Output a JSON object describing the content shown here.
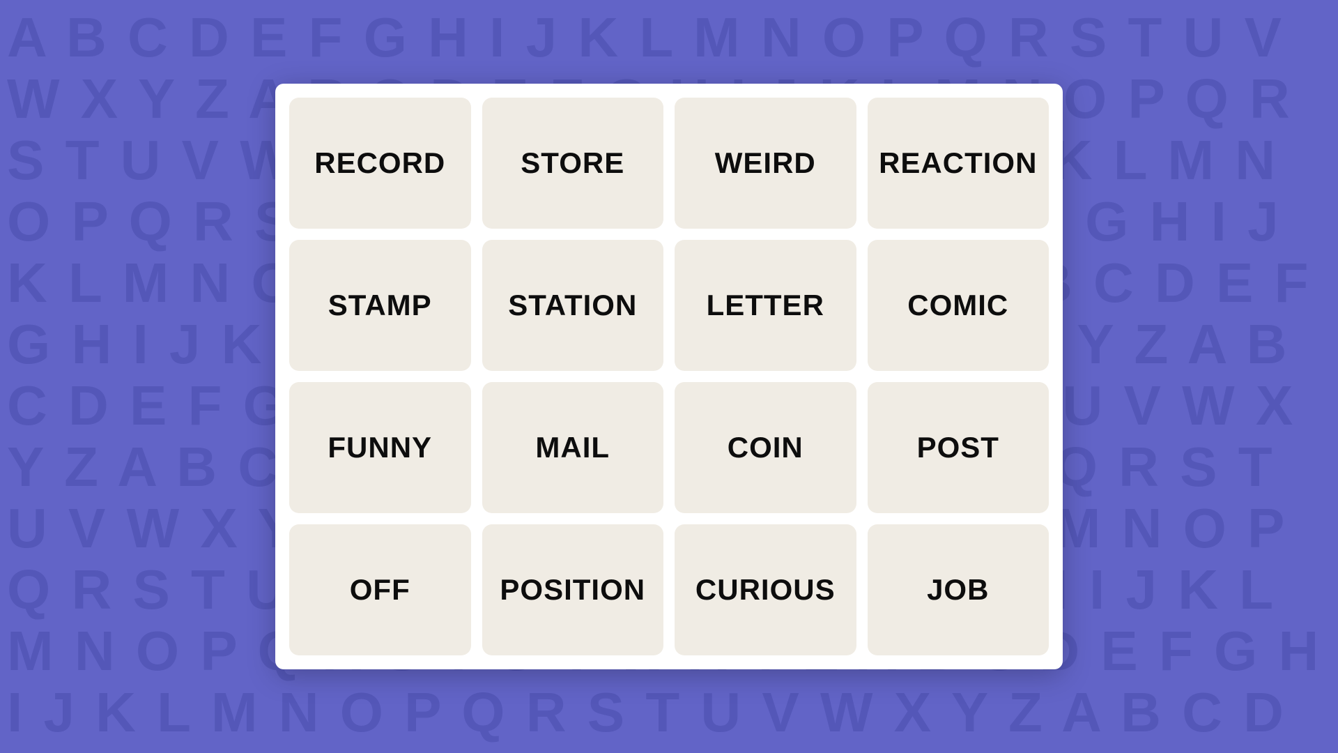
{
  "background": {
    "color": "#6264c7",
    "letter_color": "#5457b8",
    "alphabet": "ABCDEFGHIJKLMNOPQRSTUVWXYZ"
  },
  "grid": {
    "words": [
      {
        "id": "record",
        "label": "RECORD"
      },
      {
        "id": "store",
        "label": "STORE"
      },
      {
        "id": "weird",
        "label": "WEIRD"
      },
      {
        "id": "reaction",
        "label": "REACTION"
      },
      {
        "id": "stamp",
        "label": "STAMP"
      },
      {
        "id": "station",
        "label": "STATION"
      },
      {
        "id": "letter",
        "label": "LETTER"
      },
      {
        "id": "comic",
        "label": "COMIC"
      },
      {
        "id": "funny",
        "label": "FUNNY"
      },
      {
        "id": "mail",
        "label": "MAIL"
      },
      {
        "id": "coin",
        "label": "COIN"
      },
      {
        "id": "post",
        "label": "POST"
      },
      {
        "id": "off",
        "label": "OFF"
      },
      {
        "id": "position",
        "label": "POSITION"
      },
      {
        "id": "curious",
        "label": "CURIOUS"
      },
      {
        "id": "job",
        "label": "JOB"
      }
    ]
  }
}
